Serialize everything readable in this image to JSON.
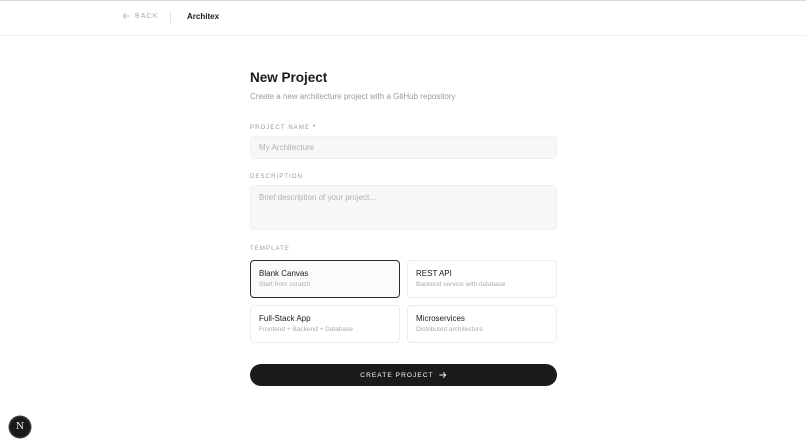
{
  "header": {
    "back_label": "BACK",
    "brand": "Architex"
  },
  "main": {
    "title": "New Project",
    "subtitle": "Create a new architecture project with a GitHub repository",
    "project_name": {
      "label": "PROJECT NAME",
      "required_mark": "*",
      "placeholder": "My Architecture",
      "value": ""
    },
    "description": {
      "label": "DESCRIPTION",
      "placeholder": "Brief description of your project...",
      "value": ""
    },
    "template": {
      "label": "TEMPLATE",
      "selected": "Blank Canvas",
      "options": [
        {
          "name": "Blank Canvas",
          "desc": "Start from scratch"
        },
        {
          "name": "REST API",
          "desc": "Backend service with database"
        },
        {
          "name": "Full-Stack App",
          "desc": "Frontend + Backend + Database"
        },
        {
          "name": "Microservices",
          "desc": "Distributed architecture"
        }
      ]
    },
    "create_label": "CREATE PROJECT"
  },
  "dev_badge": {
    "letter": "N"
  },
  "colors": {
    "primary": "#1c1b19",
    "required": "#c94b3b",
    "muted_text": "#9a9a9a",
    "input_bg": "#f7f7f5"
  },
  "icons": {
    "back": "arrow-left-icon",
    "create": "arrow-right-icon"
  }
}
